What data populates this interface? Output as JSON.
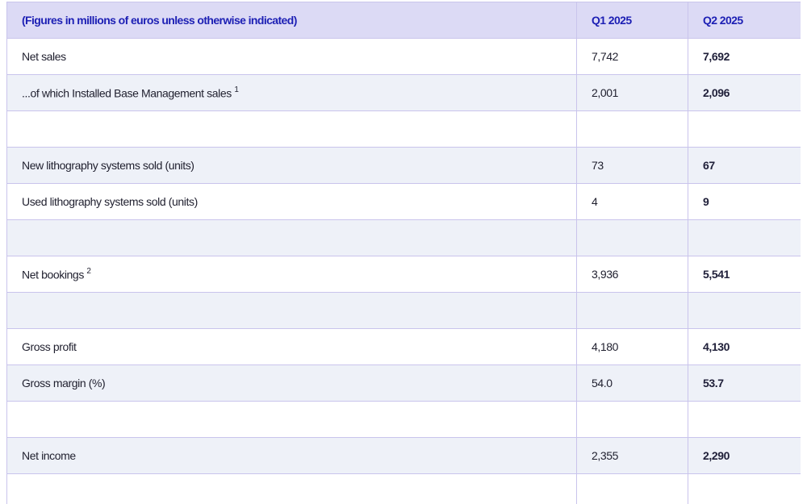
{
  "table": {
    "header": {
      "label": "(Figures in millions of euros unless otherwise indicated)",
      "q1": "Q1 2025",
      "q2": "Q2 2025"
    },
    "rows": [
      {
        "label": "Net sales",
        "sup": "",
        "q1": "7,742",
        "q2": "7,692"
      },
      {
        "label": "...of which Installed Base Management sales",
        "sup": "1",
        "q1": "2,001",
        "q2": "2,096"
      },
      {
        "label": "",
        "sup": "",
        "q1": "",
        "q2": ""
      },
      {
        "label": "New lithography systems sold (units)",
        "sup": "",
        "q1": "73",
        "q2": "67"
      },
      {
        "label": "Used lithography systems sold (units)",
        "sup": "",
        "q1": "4",
        "q2": "9"
      },
      {
        "label": "",
        "sup": "",
        "q1": "",
        "q2": ""
      },
      {
        "label": "Net bookings",
        "sup": "2",
        "q1": "3,936",
        "q2": "5,541"
      },
      {
        "label": "",
        "sup": "",
        "q1": "",
        "q2": ""
      },
      {
        "label": "Gross profit",
        "sup": "",
        "q1": "4,180",
        "q2": "4,130"
      },
      {
        "label": "Gross margin (%)",
        "sup": "",
        "q1": "54.0",
        "q2": "53.7"
      },
      {
        "label": "",
        "sup": "",
        "q1": "",
        "q2": ""
      },
      {
        "label": "Net income",
        "sup": "",
        "q1": "2,355",
        "q2": "2,290"
      }
    ]
  },
  "colors": {
    "header_bg": "#dcdaf5",
    "header_text": "#1c1fb4",
    "border": "#c9c4ec",
    "stripe": "#eef1f8"
  }
}
